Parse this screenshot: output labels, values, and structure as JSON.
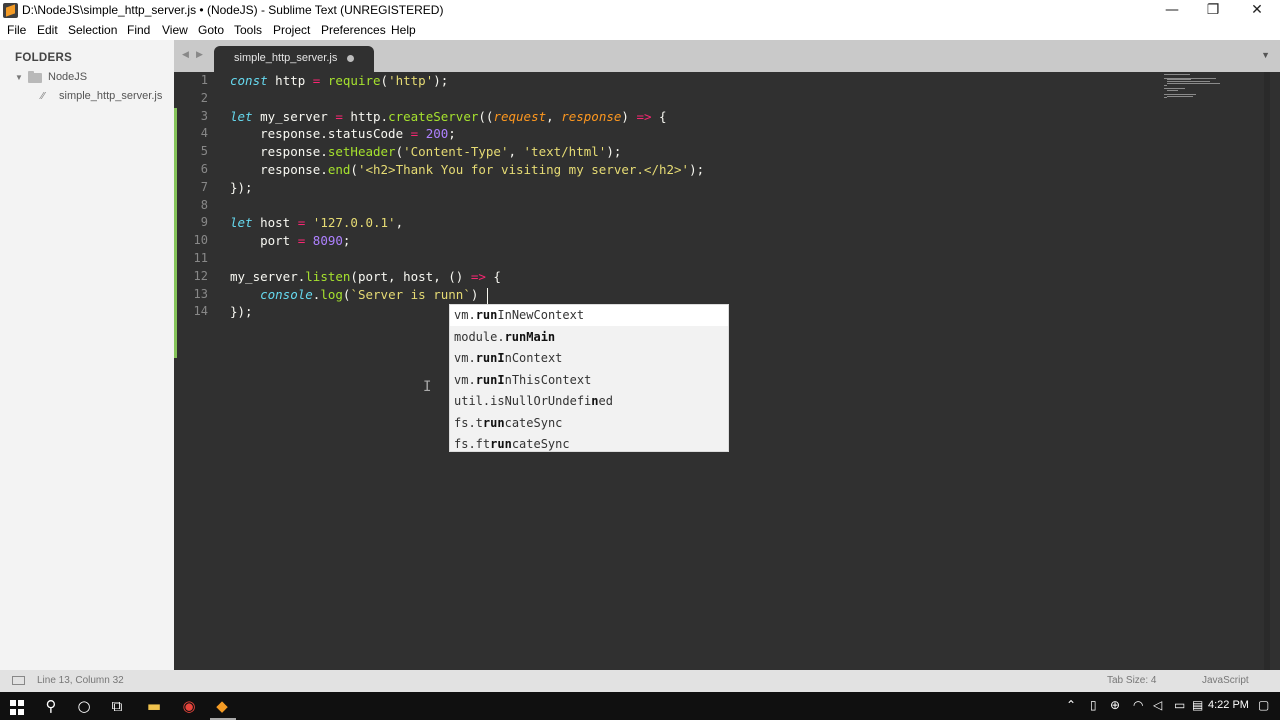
{
  "window": {
    "title": "D:\\NodeJS\\simple_http_server.js • (NodeJS) - Sublime Text (UNREGISTERED)",
    "controls": {
      "minimize": "—",
      "restore": "❐",
      "close": "✕"
    }
  },
  "menu": [
    "File",
    "Edit",
    "Selection",
    "Find",
    "View",
    "Goto",
    "Tools",
    "Project",
    "Preferences",
    "Help"
  ],
  "sidebar": {
    "header": "FOLDERS",
    "folder": "NodeJS",
    "file": "simple_http_server.js"
  },
  "tab": {
    "label": "simple_http_server.js",
    "modified": true
  },
  "editor": {
    "line_numbers": [
      "1",
      "2",
      "3",
      "4",
      "5",
      "6",
      "7",
      "8",
      "9",
      "10",
      "11",
      "12",
      "13",
      "14"
    ],
    "lines": [
      "const http = require('http');",
      "",
      "let my_server = http.createServer((request, response) => {",
      "    response.statusCode = 200;",
      "    response.setHeader('Content-Type', 'text/html');",
      "    response.end('<h2>Thank You for visiting my server.</h2>');",
      "});",
      "",
      "let host = '127.0.0.1',",
      "    port = 8090;",
      "",
      "my_server.listen(port, host, () => {",
      "    console.log(`Server is runn`)",
      "});"
    ]
  },
  "autocomplete": {
    "selected_index": 0,
    "items": [
      {
        "prefix": "vm.",
        "match": "run",
        "rest": "InNewContext"
      },
      {
        "prefix": "module.",
        "match": "runMain",
        "rest": ""
      },
      {
        "prefix": "vm.",
        "match": "runI",
        "rest": "nContext"
      },
      {
        "prefix": "vm.",
        "match": "runI",
        "rest": "nThisContext"
      },
      {
        "prefix": "util.isNullOrUndefi",
        "match": "n",
        "rest": "ed"
      },
      {
        "prefix": "fs.t",
        "match": "run",
        "rest": "cateSync"
      },
      {
        "prefix": "fs.ft",
        "match": "run",
        "rest": "cateSync"
      }
    ]
  },
  "status": {
    "position": "Line 13, Column 32",
    "tab_size": "Tab Size: 4",
    "syntax": "JavaScript"
  },
  "taskbar": {
    "time": "4:22 PM",
    "apps": [
      "windows-start",
      "search",
      "cortana",
      "task-view",
      "file-explorer",
      "chrome",
      "sublime-text"
    ]
  },
  "colors": {
    "editor_bg": "#303030",
    "keyword": "#66d9ef",
    "function": "#a6e22e",
    "string": "#e6db74",
    "number": "#ae81ff",
    "operator": "#f92672",
    "parameter": "#fd971f",
    "git_added": "#85c35a"
  }
}
